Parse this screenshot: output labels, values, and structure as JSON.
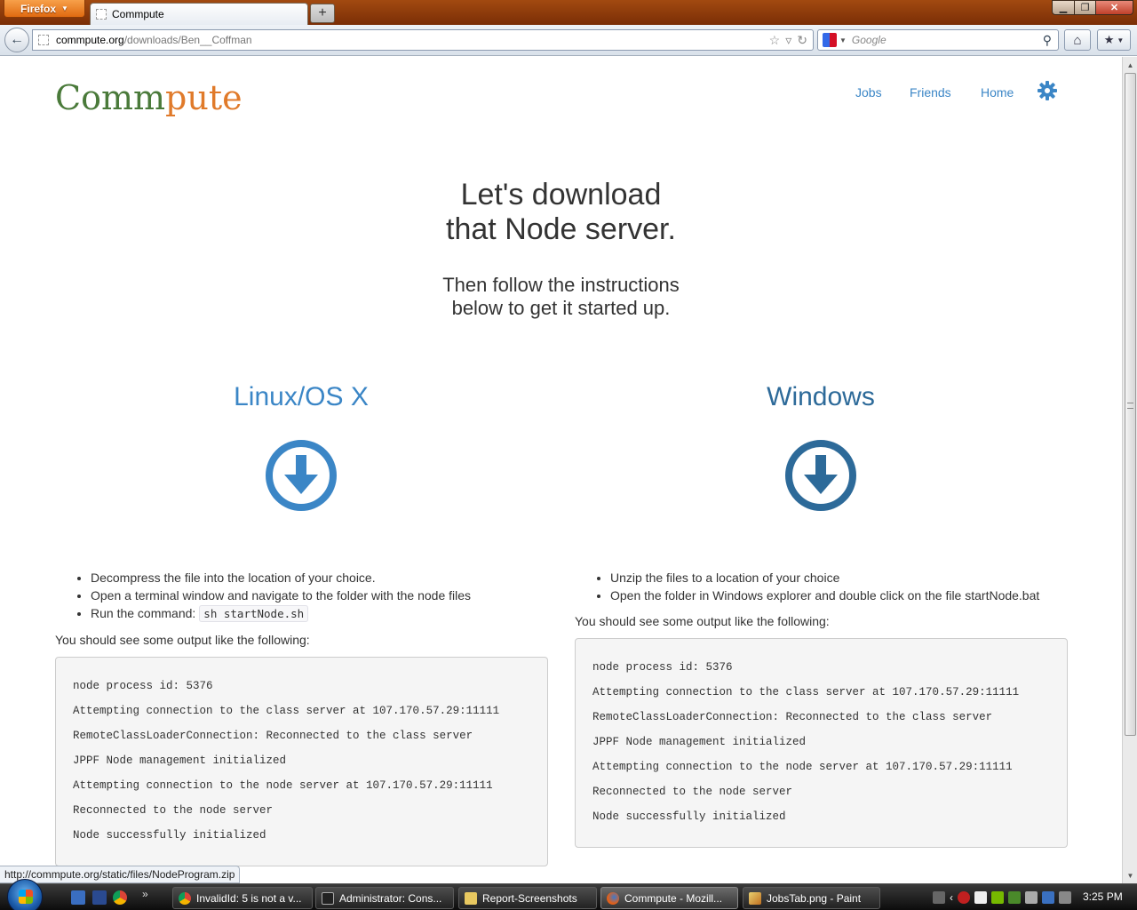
{
  "browser": {
    "menu_button": "Firefox",
    "tab_title": "Commpute",
    "new_tab": "+",
    "url_host": "commpute.org",
    "url_path": "/downloads/Ben__Coffman",
    "search_placeholder": "Google",
    "status_url": "http://commpute.org/static/files/NodeProgram.zip"
  },
  "site": {
    "brand_part1": "Comm",
    "brand_part2": "pute",
    "nav": {
      "jobs": "Jobs",
      "friends": "Friends",
      "home": "Home"
    },
    "accent_color": "#3b86c6"
  },
  "hero": {
    "title_line1": "Let's download",
    "title_line2": "that Node server.",
    "sub_line1": "Then follow the instructions",
    "sub_line2": "below to get it started up."
  },
  "linux": {
    "title": "Linux/OS X",
    "steps": [
      "Decompress the file into the location of your choice.",
      "Open a terminal window and navigate to the folder with the node files",
      "Run the command:"
    ],
    "command": "sh startNode.sh",
    "output_note": "You should see some output like the following:",
    "output_lines": [
      "node process id: 5376",
      "Attempting connection to the class server at 107.170.57.29:11111",
      "RemoteClassLoaderConnection: Reconnected to the class server",
      "JPPF Node management initialized",
      "Attempting connection to the node server at 107.170.57.29:11111",
      "Reconnected to the node server",
      "Node successfully initialized"
    ]
  },
  "windows": {
    "title": "Windows",
    "steps": [
      "Unzip the files to a location of your choice",
      "Open the folder in Windows explorer and double click on the file startNode.bat"
    ],
    "output_note": "You should see some output like the following:",
    "output_lines": [
      "node process id: 5376",
      "Attempting connection to the class server at 107.170.57.29:11111",
      "RemoteClassLoaderConnection: Reconnected to the class server",
      "JPPF Node management initialized",
      "Attempting connection to the node server at 107.170.57.29:11111",
      "Reconnected to the node server",
      "Node successfully initialized"
    ]
  },
  "taskbar": {
    "tasks": [
      "InvalidId: 5 is not a v...",
      "Administrator: Cons...",
      "Report-Screenshots",
      "Commpute - Mozill...",
      "JobsTab.png - Paint"
    ],
    "clock": "3:25 PM"
  }
}
